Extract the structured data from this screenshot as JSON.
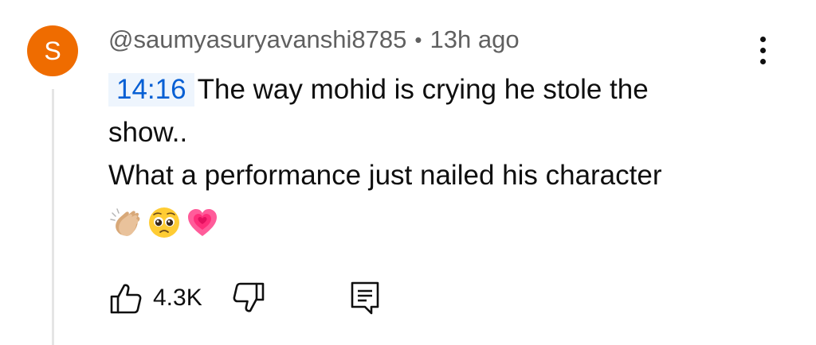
{
  "comment": {
    "avatar_letter": "S",
    "avatar_color": "#ef6c00",
    "author": "@saumyasuryavanshi8785",
    "separator": "•",
    "time_ago": "13h ago",
    "timestamp_link": "14:16",
    "text_line1": "The way mohid is crying he stole the",
    "text_line2": "show..",
    "text_line3": "What a performance just nailed his character",
    "emojis": [
      "clapping-hands",
      "pleading-face",
      "growing-heart"
    ]
  },
  "actions": {
    "like_count": "4.3K",
    "like_icon": "thumbs-up-icon",
    "dislike_icon": "thumbs-down-icon",
    "reply_icon": "reply-comment-icon"
  },
  "colors": {
    "timestamp_bg": "#eef5fd",
    "timestamp_text": "#065fd4",
    "meta_text": "#606060"
  }
}
